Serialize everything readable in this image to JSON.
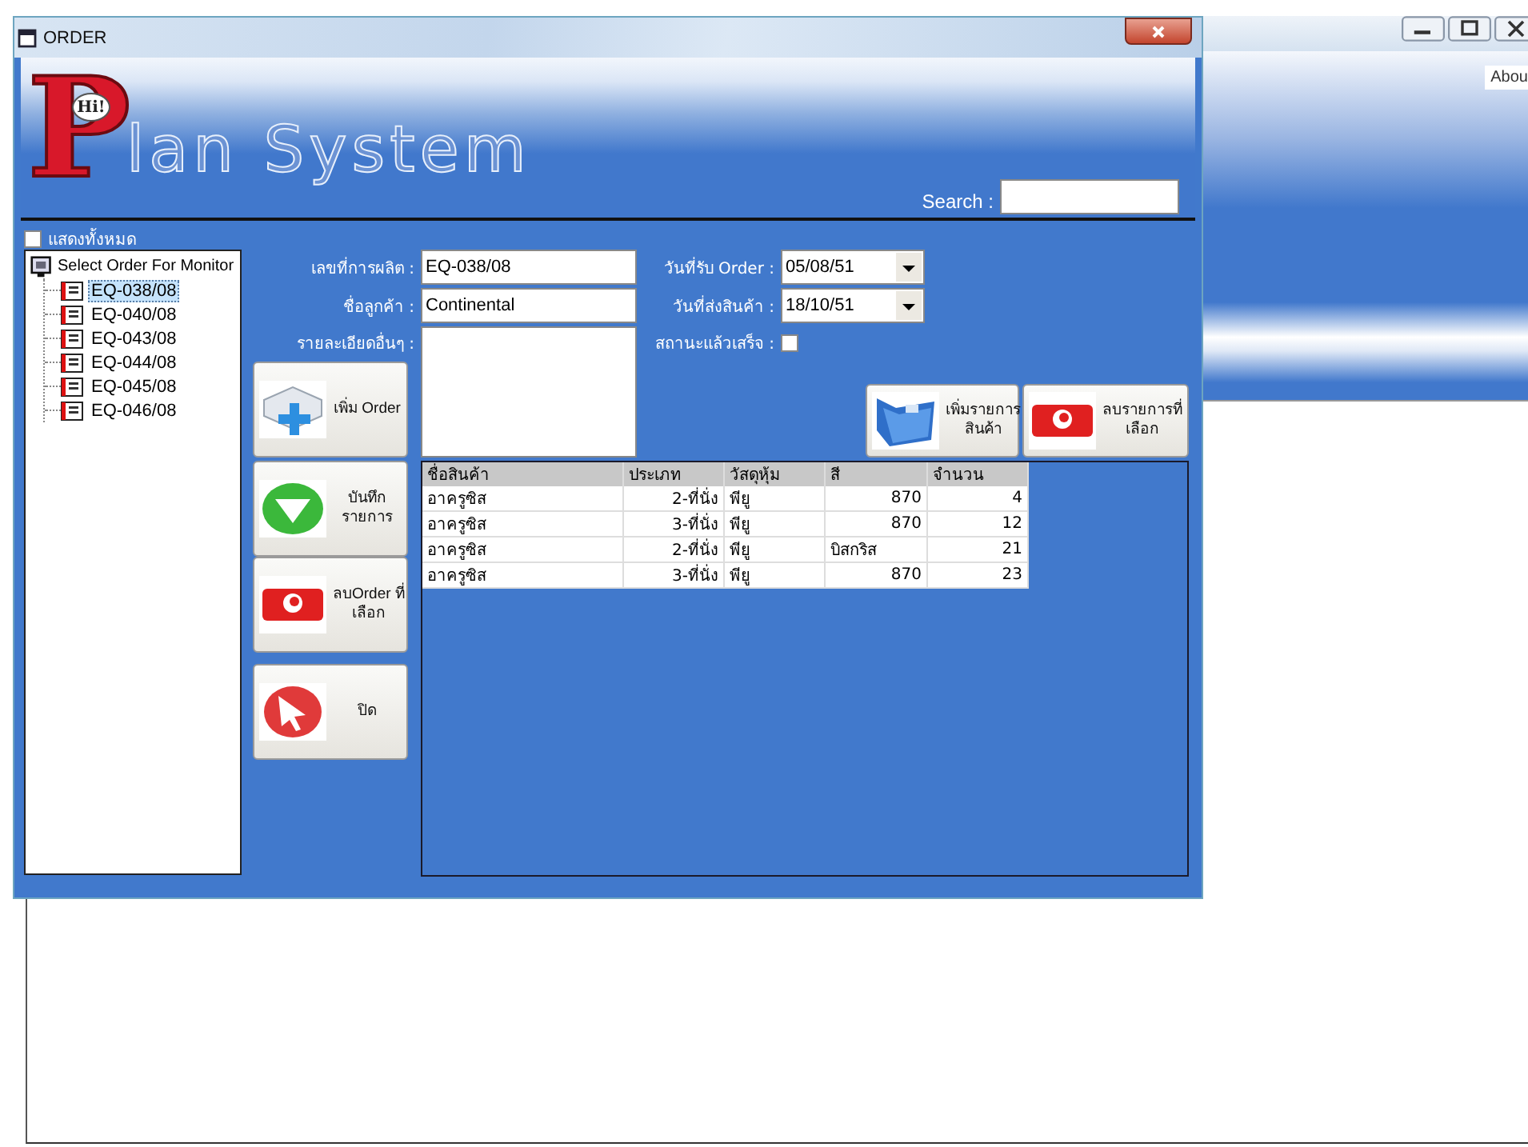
{
  "back_window": {
    "tab": "Abou"
  },
  "window": {
    "title": "ORDER"
  },
  "logo": {
    "badge": "Hi!",
    "initial": "P",
    "rest": "lan System"
  },
  "search": {
    "label": "Search :"
  },
  "show_all": {
    "label": "แสดงทั้งหมด",
    "checked": false
  },
  "tree": {
    "root": "Select Order For Monitor",
    "children": [
      {
        "label": "EQ-038/08",
        "selected": true
      },
      {
        "label": "EQ-040/08",
        "selected": false
      },
      {
        "label": "EQ-043/08",
        "selected": false
      },
      {
        "label": "EQ-044/08",
        "selected": false
      },
      {
        "label": "EQ-045/08",
        "selected": false
      },
      {
        "label": "EQ-046/08",
        "selected": false
      }
    ]
  },
  "form": {
    "order_no": {
      "label": "เลขที่การผลิต :",
      "value": "EQ-038/08"
    },
    "customer": {
      "label": "ชื่อลูกค้า :",
      "value": "Continental"
    },
    "details": {
      "label": "รายละเอียดอื่นๆ :"
    },
    "received": {
      "label": "วันที่รับ Order :",
      "value": "05/08/51"
    },
    "delivery": {
      "label": "วันที่ส่งสินค้า :",
      "value": "18/10/51"
    },
    "done": {
      "label": "สถานะแล้วเสร็จ :",
      "checked": false
    }
  },
  "side_buttons": [
    {
      "label": "เพิ่ม Order",
      "kind": "add"
    },
    {
      "label": "บันทึก\nรายการ",
      "kind": "save"
    },
    {
      "label": "ลบOrder ที่\nเลือก",
      "kind": "delete"
    },
    {
      "label": "ปิด",
      "kind": "close"
    }
  ],
  "item_buttons": [
    {
      "label": "เพิ่มรายการ\nสินค้า",
      "kind": "folder"
    },
    {
      "label": "ลบรายการที่\nเลือก",
      "kind": "delete"
    }
  ],
  "table": {
    "columns": [
      "ชื่อสินค้า",
      "ประเภท",
      "วัสดุหุ้ม",
      "สี",
      "จำนวน"
    ],
    "rows": [
      [
        "อาครูซิส",
        "2-ที่นั่ง",
        "พียู",
        "870",
        "4"
      ],
      [
        "อาครูซิส",
        "3-ที่นั่ง",
        "พียู",
        "870",
        "12"
      ],
      [
        "อาครูซิส",
        "2-ที่นั่ง",
        "พียู",
        "บิสกริส",
        "21"
      ],
      [
        "อาครูซิส",
        "3-ที่นั่ง",
        "พียู",
        "870",
        "23"
      ]
    ]
  }
}
